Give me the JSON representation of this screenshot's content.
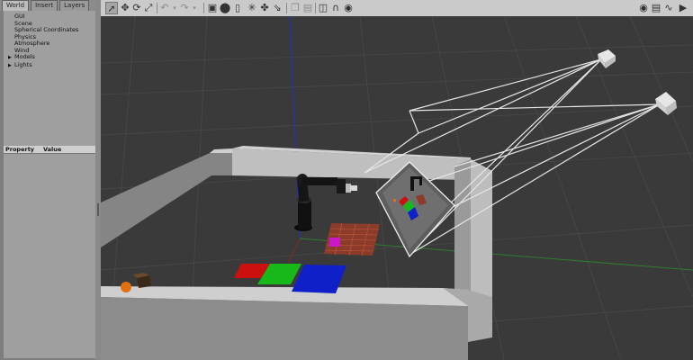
{
  "tabs": [
    "World",
    "Insert",
    "Layers"
  ],
  "world_tree": [
    {
      "label": "GUI",
      "expandable": false
    },
    {
      "label": "Scene",
      "expandable": false
    },
    {
      "label": "Spherical Coordinates",
      "expandable": false
    },
    {
      "label": "Physics",
      "expandable": false
    },
    {
      "label": "Atmosphere",
      "expandable": false
    },
    {
      "label": "Wind",
      "expandable": false
    },
    {
      "label": "Models",
      "expandable": true
    },
    {
      "label": "Lights",
      "expandable": true
    }
  ],
  "properties": {
    "col_property": "Property",
    "col_value": "Value"
  },
  "toolbar_icons": {
    "select": "arrow-pointer-icon",
    "translate": "move-arrows-icon",
    "rotate": "rotate-icon",
    "scale": "scale-icon",
    "undo": "undo-icon",
    "redo": "redo-icon",
    "box": "box-shape-icon",
    "sphere": "sphere-shape-icon",
    "cylinder": "cylinder-shape-icon",
    "point_light": "point-light-icon",
    "spot_light": "spot-light-icon",
    "directional_light": "directional-light-icon",
    "copy": "copy-icon",
    "paste": "paste-icon",
    "align": "align-icon",
    "snap": "snap-magnet-icon",
    "change_view": "view-angle-icon",
    "screenshot": "camera-icon",
    "record": "record-icon",
    "plot": "plot-icon",
    "video": "video-icon"
  },
  "colors": {
    "panel_bg": "#7e7e7e",
    "toolbar_bg": "#cacaca",
    "viewport_bg": "#3a3a3a",
    "mat_red": "#cc1010",
    "mat_green": "#17b81a",
    "mat_blue": "#1020c8",
    "cube_magenta": "#c818c8",
    "ball_orange": "#e07010"
  }
}
